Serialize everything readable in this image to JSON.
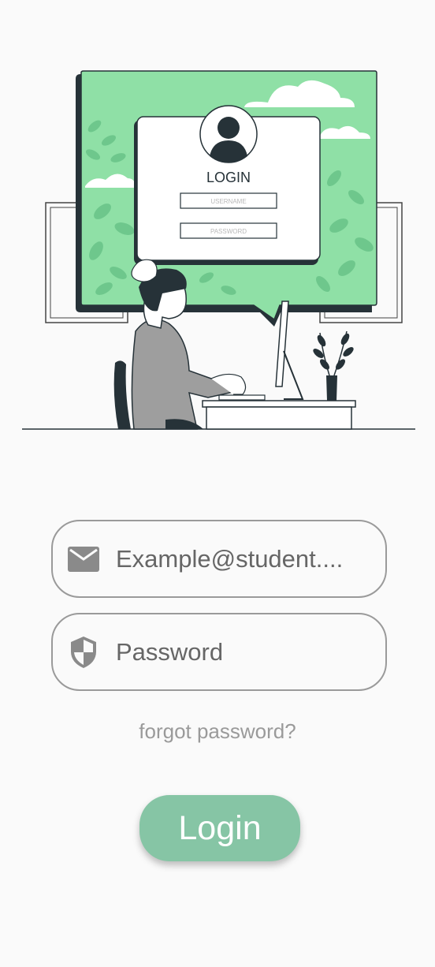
{
  "illustration": {
    "card_title": "LOGIN",
    "username_placeholder": "USERNAME",
    "password_placeholder": "PASSWORD"
  },
  "form": {
    "email_placeholder": "Example@student....",
    "email_icon": "mail-icon",
    "password_placeholder": "Password",
    "password_icon": "shield-icon",
    "forgot_label": "forgot password?",
    "login_label": "Login"
  },
  "colors": {
    "background": "#fafafa",
    "accent": "#86c5a5",
    "illustration_green": "#8fe0a6"
  }
}
